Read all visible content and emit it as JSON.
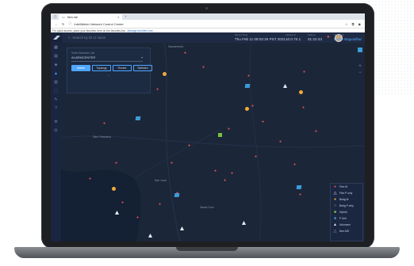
{
  "browser": {
    "tab_title": "New tab",
    "url": "IntelliMeter Network Control Center",
    "bookmarks_text": "For quick access, place your favorites here on the favorites bar.",
    "bookmarks_link": "Manage favorites now"
  },
  "topbar": {
    "search_placeholder": "Search by ID or name",
    "server_time_label": "Server Time",
    "server_time_value": "Thu Feb 11 08:02:26 PST 2021",
    "version_label": "Version #",
    "version_value": "10.0.70.1",
    "uptime_label": "Uptime",
    "uptime_value": "01:22:43",
    "user_label": "Welcome",
    "user_value": "Lowie Bagvadhar"
  },
  "panel": {
    "label": "Select Business Unit",
    "selected": "ALARMCENTER",
    "tabs": [
      "Nodes",
      "Topology",
      "Routes",
      "Statistics"
    ]
  },
  "map": {
    "cities": [
      {
        "name": "Sacramento"
      },
      {
        "name": "San Francisco"
      },
      {
        "name": "San Jose"
      },
      {
        "name": "Santa Cruz"
      }
    ]
  },
  "legend": {
    "items": [
      {
        "label": "Flex M",
        "icon": "red-drop-icon"
      },
      {
        "label": "Flex P only",
        "icon": "white-outline-triangle-icon"
      },
      {
        "label": "Bridg M",
        "icon": "yellow-circle-icon"
      },
      {
        "label": "Bridg P only",
        "icon": "yellow-outline-circle-icon"
      },
      {
        "label": "Hybrid",
        "icon": "green-square-icon"
      },
      {
        "label": "P Unk",
        "icon": "blue-square-icon"
      },
      {
        "label": "Unknown",
        "icon": "white-triangle-icon"
      },
      {
        "label": "Non-MS",
        "icon": "gray-triangle-icon"
      }
    ]
  },
  "colors": {
    "accent": "#4fa7ff",
    "flex": "#e0514f",
    "bridge": "#f1a93a",
    "hybrid": "#7bc043",
    "punk": "#3d9bd6"
  }
}
